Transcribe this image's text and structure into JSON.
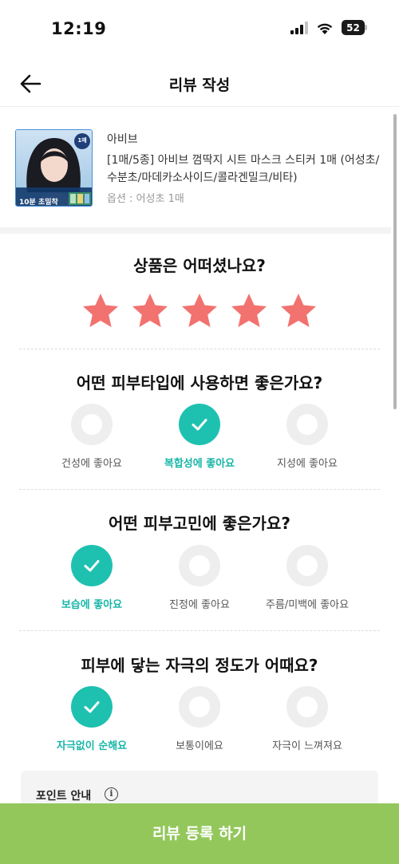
{
  "status_bar": {
    "time": "12:19",
    "battery": "52"
  },
  "header": {
    "title": "리뷰 작성",
    "back_icon": "arrow-left-icon"
  },
  "product": {
    "brand": "아비브",
    "name": "[1매/5종] 아비브 껌딱지 시트 마스크 스티커 1매 (어성초/수분초/마데카소사이드/콜라겐밀크/비타)",
    "option": "옵션 : 어성초 1매",
    "thumb_badge": "1매",
    "thumb_caption": "10분 초밀착"
  },
  "rating": {
    "question": "상품은 어떠셨나요?",
    "stars": 5,
    "max": 5,
    "star_color": "#f2726f"
  },
  "skin_type": {
    "question": "어떤 피부타입에 사용하면 좋은가요?",
    "options": [
      {
        "label": "건성에 좋아요",
        "selected": false
      },
      {
        "label": "복합성에 좋아요",
        "selected": true
      },
      {
        "label": "지성에 좋아요",
        "selected": false
      }
    ]
  },
  "skin_concern": {
    "question": "어떤 피부고민에 좋은가요?",
    "options": [
      {
        "label": "보습에 좋아요",
        "selected": true
      },
      {
        "label": "진정에 좋아요",
        "selected": false
      },
      {
        "label": "주름/미백에 좋아요",
        "selected": false
      }
    ]
  },
  "irritation": {
    "question": "피부에 닿는 자극의 정도가 어때요?",
    "options": [
      {
        "label": "자극없이 순해요",
        "selected": true
      },
      {
        "label": "보통이에요",
        "selected": false
      },
      {
        "label": "자극이 느껴져요",
        "selected": false
      }
    ]
  },
  "point_info": {
    "title": "포인트 안내",
    "icon": "info-icon"
  },
  "footer": {
    "submit_label": "리뷰 등록 하기"
  },
  "colors": {
    "accent": "#1ec1b0",
    "accent_text": "#18b6a8",
    "submit": "#93c75b",
    "star": "#f2726f"
  }
}
